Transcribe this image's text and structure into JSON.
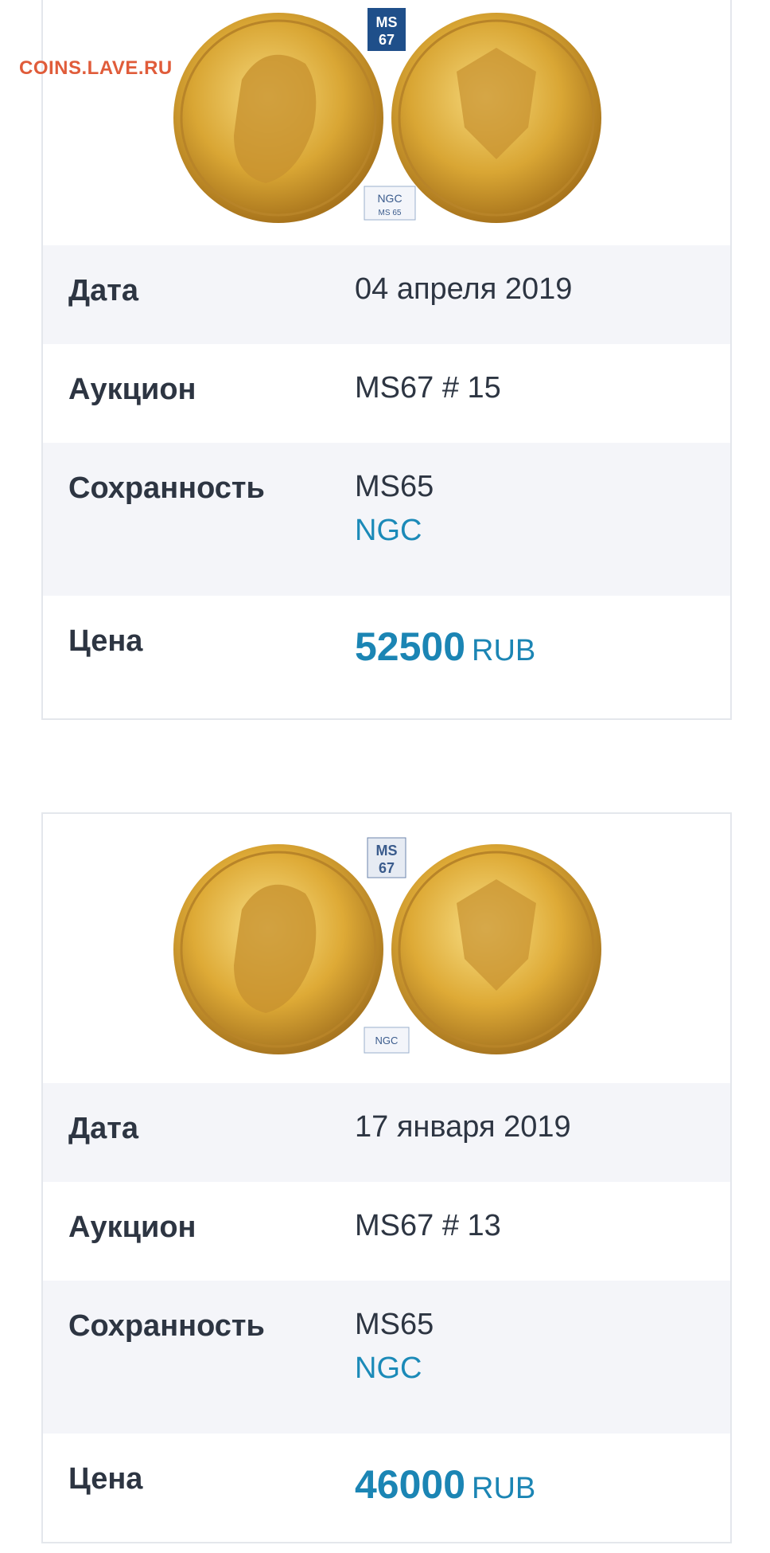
{
  "watermark": "COINS.LAVE.RU",
  "labels": {
    "date": "Дата",
    "auction": "Аукцион",
    "condition": "Сохранность",
    "price": "Цена"
  },
  "lots": [
    {
      "date": "04 апреля 2019",
      "auction": "MS67 # 15",
      "grade": "MS65",
      "grader": "NGC",
      "price": "52500",
      "currency": "RUB",
      "slab_label": "MS 67"
    },
    {
      "date": "17 января 2019",
      "auction": "MS67 # 13",
      "grade": "MS65",
      "grader": "NGC",
      "price": "46000",
      "currency": "RUB",
      "slab_label": "MS 67"
    }
  ],
  "colors": {
    "accent": "#1b85b4",
    "gold": "#d9a634",
    "watermark": "#e05c3a",
    "row_shade": "#f4f5f9"
  }
}
